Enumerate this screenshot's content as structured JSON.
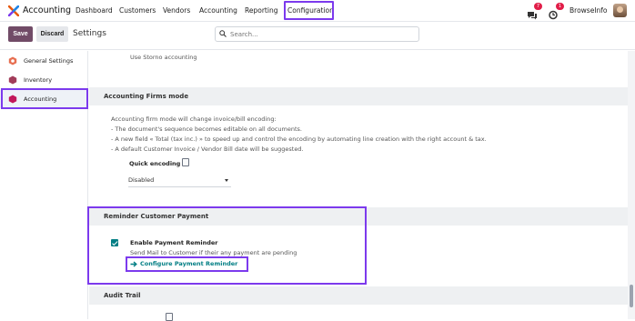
{
  "topbar": {
    "app_name": "Accounting",
    "menu": [
      "Dashboard",
      "Customers",
      "Vendors",
      "Accounting",
      "Reporting",
      "Configuration"
    ],
    "chat_badge": "7",
    "activity_badge": "1",
    "user_name": "BrowseInfo"
  },
  "controlbar": {
    "save_label": "Save",
    "discard_label": "Discard",
    "title": "Settings",
    "search_placeholder": "Search..."
  },
  "sidebar": {
    "items": [
      {
        "label": "General Settings",
        "icon": "odoo-logo-icon",
        "color": "#e76f51"
      },
      {
        "label": "Inventory",
        "icon": "inventory-icon",
        "color": "#a23d5a"
      },
      {
        "label": "Accounting",
        "icon": "accounting-icon",
        "color": "#c2185b"
      }
    ]
  },
  "content": {
    "storno_label": "Use Storno accounting",
    "firms": {
      "title": "Accounting Firms mode",
      "lines": [
        "Accounting firm mode will change invoice/bill encoding:",
        "- The document's sequence becomes editable on all documents.",
        "- A new field « Total (tax inc.) » to speed up and control the encoding by automating line creation with the right account & tax.",
        "- A default Customer Invoice / Vendor Bill date will be suggested."
      ],
      "quick_encoding_label": "Quick encoding",
      "quick_encoding_value": "Disabled"
    },
    "reminder": {
      "title": "Reminder Customer Payment",
      "enable_label": "Enable Payment Reminder",
      "enable_desc": "Send Mail to Customer if their any payment are pending",
      "configure_link": "Configure Payment Reminder"
    },
    "audit": {
      "title": "Audit Trail"
    }
  },
  "colors": {
    "accent": "#7c3aed",
    "primary": "#714b67",
    "teal": "#017e84"
  }
}
